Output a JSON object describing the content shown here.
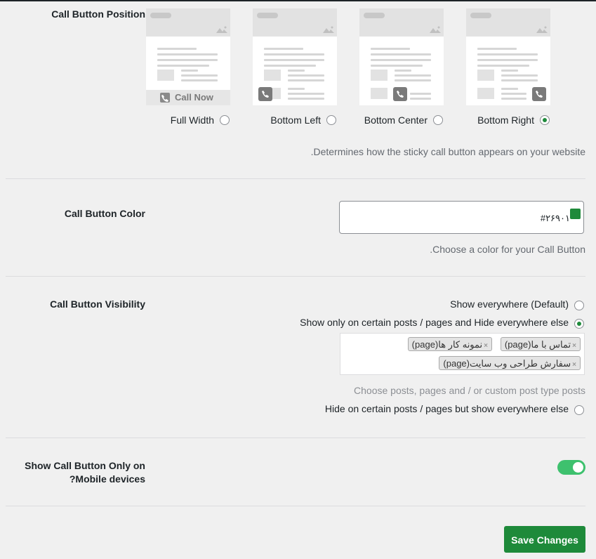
{
  "position": {
    "label": "Call Button Position",
    "options": [
      {
        "label": "Full Width",
        "selected": false
      },
      {
        "label": "Bottom Left",
        "selected": false
      },
      {
        "label": "Bottom Center",
        "selected": false
      },
      {
        "label": "Bottom Right",
        "selected": true
      }
    ],
    "call_now_text": "Call Now",
    "description": "Determines how the sticky call button appears on your website."
  },
  "color": {
    "label": "Call Button Color",
    "value": "#۲۶۹۰۱",
    "swatch": "#1e8a3a",
    "description": "Choose a color for your Call Button."
  },
  "visibility": {
    "label": "Call Button Visibility",
    "options": [
      {
        "label": "Show everywhere (Default)",
        "selected": false
      },
      {
        "label": "Show only on certain posts / pages and Hide everywhere else",
        "selected": true
      },
      {
        "label": "Hide on certain posts / pages but show everywhere else",
        "selected": false
      }
    ],
    "tags": [
      "تماس با ما(page)",
      "نمونه کار ها(page)",
      "سفارش طراحی وب سایت(page)"
    ],
    "tag_remove": "×",
    "tags_hint": "Choose posts, pages and / or custom post type posts"
  },
  "mobile": {
    "label_line1": "Show Call Button Only on",
    "label_line2": "Mobile devices?",
    "enabled": true
  },
  "save_label": "Save Changes",
  "colors": {
    "accent": "#1e8a3a",
    "toggle": "#3ec16e"
  }
}
